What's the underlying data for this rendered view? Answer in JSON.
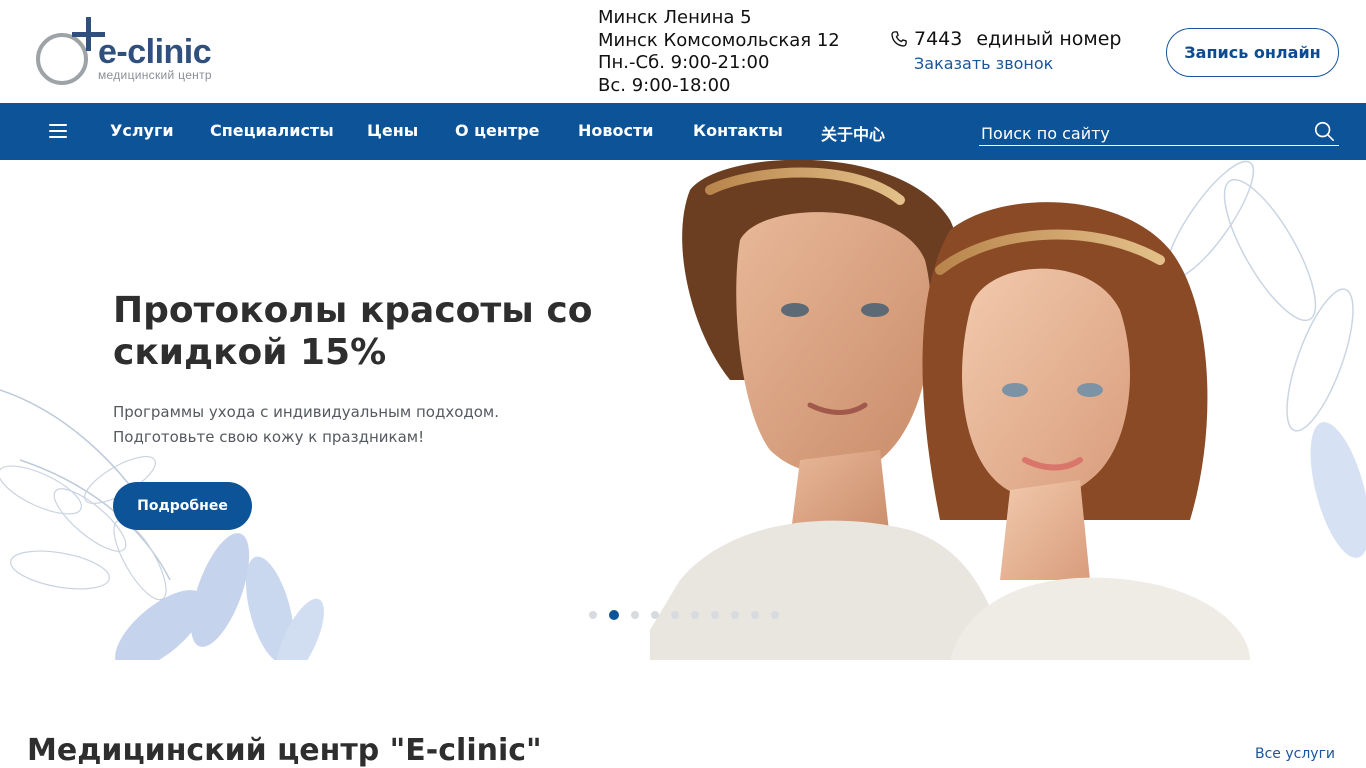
{
  "header": {
    "logo": {
      "name": "e-clinic",
      "subtitle": "медицинский центр"
    },
    "addresses": [
      "Минск Ленина 5",
      "Минск Комсомольская 12",
      "Пн.-Сб. 9:00-21:00",
      "Вс. 9:00-18:00"
    ],
    "phone": {
      "number": "7443",
      "label": "единый номер",
      "callback": "Заказать звонок"
    },
    "book_button": "Запись онлайн"
  },
  "nav": {
    "menu_icon": "hamburger-menu-icon",
    "items": [
      "Услуги",
      "Специалисты",
      "Цены",
      "О центре",
      "Новости",
      "Контакты",
      "关于中心"
    ],
    "search_placeholder": "Поиск по сайту",
    "search_icon": "search-icon"
  },
  "hero": {
    "title": "Протоколы красоты со скидкой 15%",
    "text": "Программы ухода с индивидуальным подходом. Подготовьте свою кожу к праздникам!",
    "button": "Подробнее",
    "slides_total": 10,
    "active_slide": 2
  },
  "section": {
    "title": "Медицинский центр \"E-clinic\"",
    "link": "Все услуги"
  },
  "colors": {
    "primary": "#0c5398",
    "link": "#1c559a",
    "text_dark": "#2e2e2e"
  }
}
